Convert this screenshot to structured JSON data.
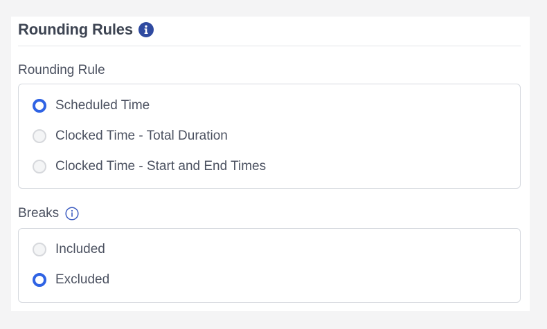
{
  "header": {
    "title": "Rounding Rules",
    "info_icon": "info-circle-solid-icon",
    "accent_color": "#2f4aa0"
  },
  "rounding_rule": {
    "label": "Rounding Rule",
    "options": [
      {
        "label": "Scheduled Time",
        "selected": true
      },
      {
        "label": "Clocked Time - Total Duration",
        "selected": false
      },
      {
        "label": "Clocked Time - Start and End Times",
        "selected": false
      }
    ]
  },
  "breaks": {
    "label": "Breaks",
    "info_icon": "info-circle-outline-icon",
    "options": [
      {
        "label": "Included",
        "selected": false
      },
      {
        "label": "Excluded",
        "selected": true
      }
    ]
  },
  "colors": {
    "radio_selected": "#2f63e4",
    "text": "#4b5160",
    "border": "#d5d8de"
  }
}
